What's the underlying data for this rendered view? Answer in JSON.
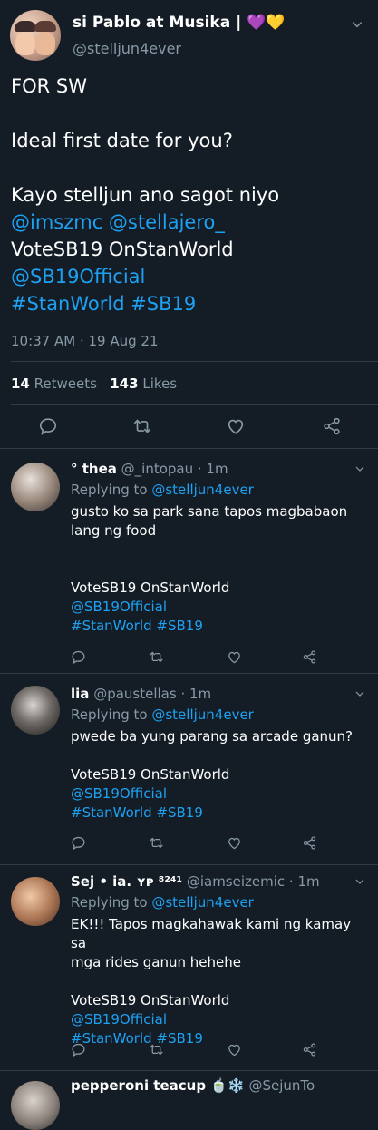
{
  "tweet": {
    "display_name": "si Pablo at Musika | 💜💛",
    "handle": "@stelljun4ever",
    "body": [
      {
        "text": "FOR SW",
        "link": false
      },
      {
        "text": "",
        "link": false
      },
      {
        "text": "Ideal first date for you?",
        "link": false
      },
      {
        "text": "",
        "link": false
      },
      {
        "text": "Kayo stelljun ano sagot niyo",
        "link": false
      },
      {
        "text": "@imszmc @stellajero_",
        "link": true
      },
      {
        "text": "VoteSB19 OnStanWorld",
        "link": false
      },
      {
        "text": "@SB19Official",
        "link": true
      },
      {
        "text": "#StanWorld #SB19",
        "link": true
      }
    ],
    "timestamp": "10:37 AM · 19 Aug 21",
    "retweets": "14",
    "retweets_label": "Retweets",
    "likes": "143",
    "likes_label": "Likes"
  },
  "replies": [
    {
      "name": "° thea",
      "handle": "@_intopau",
      "time": "· 1m",
      "replying_prefix": "Replying to",
      "replying_to": "@stelljun4ever",
      "lines": [
        {
          "text": "gusto ko sa park sana tapos magbabaon",
          "link": false
        },
        {
          "text": "lang ng food",
          "link": false
        },
        {
          "text": "",
          "link": false
        },
        {
          "text": "",
          "link": false
        },
        {
          "text": "VoteSB19 OnStanWorld",
          "link": false
        },
        {
          "text": "@SB19Official",
          "link": true
        },
        {
          "text": "#StanWorld #SB19",
          "link": true
        }
      ]
    },
    {
      "name": "lia",
      "handle": "@paustellas",
      "time": "· 1m",
      "replying_prefix": "Replying to",
      "replying_to": "@stelljun4ever",
      "lines": [
        {
          "text": "pwede ba yung parang sa arcade ganun?",
          "link": false
        },
        {
          "text": "",
          "link": false
        },
        {
          "text": "VoteSB19 OnStanWorld",
          "link": false
        },
        {
          "text": "@SB19Official",
          "link": true
        },
        {
          "text": "#StanWorld #SB19",
          "link": true
        }
      ]
    },
    {
      "name": "Sej • ia. ʏᴘ ⁸²⁴¹",
      "handle": "@iamseizemic",
      "time": "· 1m",
      "replying_prefix": "Replying to",
      "replying_to": "@stelljun4ever",
      "lines": [
        {
          "text": "EK!!! Tapos magkahawak kami ng kamay sa",
          "link": false
        },
        {
          "text": "mga rides ganun hehehe",
          "link": false
        },
        {
          "text": "",
          "link": false
        },
        {
          "text": "VoteSB19 OnStanWorld",
          "link": false
        },
        {
          "text": "@SB19Official",
          "link": true
        },
        {
          "text": "#StanWorld #SB19",
          "link": true
        }
      ]
    },
    {
      "name": "pepperoni teacup 🍵❄️",
      "handle": "@SejunTo",
      "time": "",
      "replying_prefix": "",
      "replying_to": "",
      "lines": []
    }
  ],
  "colors": {
    "background": "#141d26",
    "link": "#1da1f2",
    "muted": "#8899a6",
    "divider": "#2f3b47"
  },
  "icons": [
    "chevron-down-icon",
    "reply-icon",
    "retweet-icon",
    "like-icon",
    "share-icon"
  ]
}
